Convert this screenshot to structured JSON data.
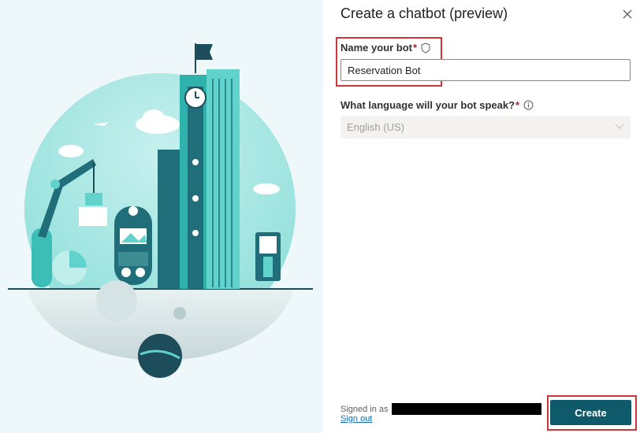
{
  "dialog": {
    "title": "Create a chatbot (preview)",
    "close_icon": "close-icon"
  },
  "name_field": {
    "label": "Name your bot",
    "required_marker": "*",
    "icon": "shield-icon",
    "value": "Reservation Bot"
  },
  "language_field": {
    "label": "What language will your bot speak?",
    "required_marker": "*",
    "icon": "info-icon",
    "selected": "English (US)",
    "disabled": true
  },
  "footer": {
    "signed_in_label": "Signed in as",
    "sign_out_label": "Sign out",
    "create_label": "Create"
  },
  "colors": {
    "accent": "#0e5a6b",
    "highlight": "#d13438",
    "illustration_teal": "#5fd3cc"
  }
}
